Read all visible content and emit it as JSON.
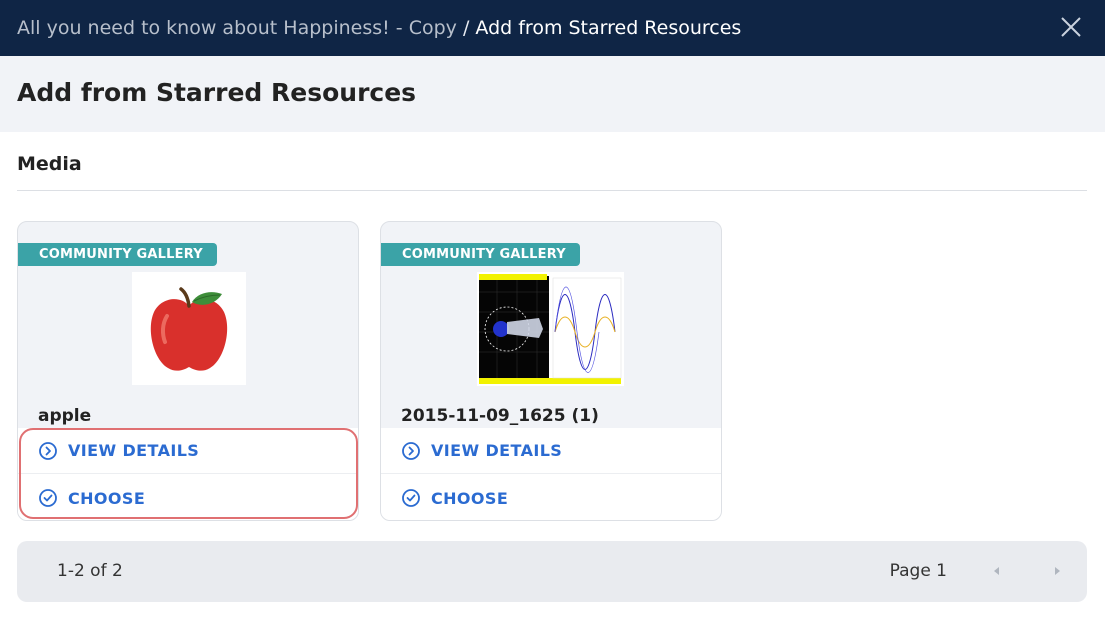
{
  "topbar": {
    "parent": "All you need to know about Happiness! - Copy",
    "separator": "/",
    "current": "Add from Starred Resources",
    "close_icon": "close-icon"
  },
  "header": {
    "title": "Add from Starred Resources"
  },
  "section": {
    "title": "Media"
  },
  "cards": [
    {
      "badge": "COMMUNITY GALLERY",
      "name": "apple",
      "view_label": "VIEW DETAILS",
      "choose_label": "CHOOSE",
      "thumbnail": "apple-image"
    },
    {
      "badge": "COMMUNITY GALLERY",
      "name": "2015-11-09_1625 (1)",
      "view_label": "VIEW DETAILS",
      "choose_label": "CHOOSE",
      "thumbnail": "simulation-screenshot-image"
    }
  ],
  "pagination": {
    "range": "1-2 of 2",
    "page": "Page 1",
    "prev_icon": "chevron-left-icon",
    "next_icon": "chevron-right-icon"
  },
  "colors": {
    "topbar": "#0f2545",
    "badge": "#3ba3a7",
    "action": "#2b6bd1",
    "highlight": "#e07072"
  }
}
